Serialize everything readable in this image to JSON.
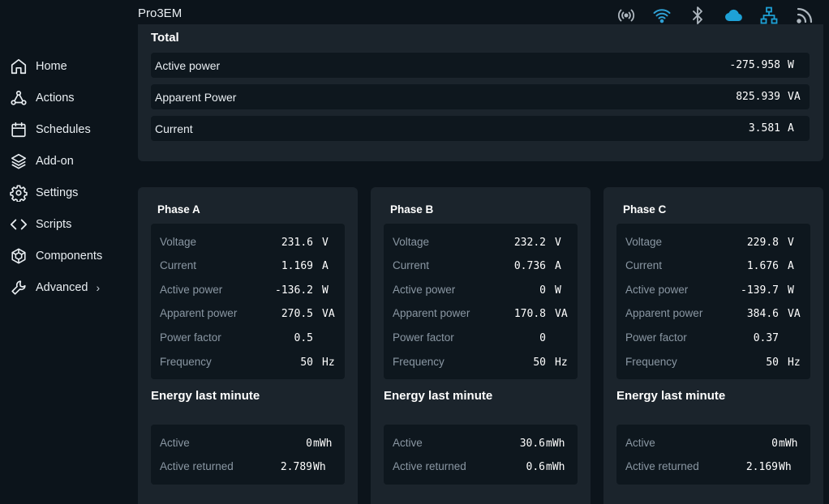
{
  "app": {
    "title": "Pro3EM"
  },
  "status_icons": [
    {
      "name": "broadcast-icon",
      "color": "#aeb7bf"
    },
    {
      "name": "wifi-icon",
      "color": "#2f9fd3"
    },
    {
      "name": "bluetooth-icon",
      "color": "#aeb7bf"
    },
    {
      "name": "cloud-icon",
      "color": "#1ea1d6"
    },
    {
      "name": "ethernet-icon",
      "color": "#1ea1d6"
    },
    {
      "name": "rss-icon",
      "color": "#aeb7bf"
    }
  ],
  "sidebar": {
    "items": [
      {
        "label": "Home",
        "icon": "home-icon"
      },
      {
        "label": "Actions",
        "icon": "actions-icon"
      },
      {
        "label": "Schedules",
        "icon": "calendar-icon"
      },
      {
        "label": "Add-on",
        "icon": "layers-icon"
      },
      {
        "label": "Settings",
        "icon": "gear-icon"
      },
      {
        "label": "Scripts",
        "icon": "code-icon"
      },
      {
        "label": "Components",
        "icon": "components-icon"
      },
      {
        "label": "Advanced",
        "icon": "wrench-icon",
        "has_submenu": true,
        "chevron": "›"
      }
    ]
  },
  "total": {
    "title": "Total",
    "rows": [
      {
        "label": "Active power",
        "value": "-275.958",
        "unit": "W"
      },
      {
        "label": "Apparent Power",
        "value": "825.939",
        "unit": "VA"
      },
      {
        "label": "Current",
        "value": "3.581",
        "unit": "A"
      }
    ]
  },
  "phases": [
    {
      "title": "Phase A",
      "rows": [
        {
          "label": "Voltage",
          "value": "231.6",
          "unit": "V"
        },
        {
          "label": "Current",
          "value": "1.169",
          "unit": "A"
        },
        {
          "label": "Active power",
          "value": "-136.2",
          "unit": "W"
        },
        {
          "label": "Apparent power",
          "value": "270.5",
          "unit": "VA"
        },
        {
          "label": "Power factor",
          "value": "0.5",
          "unit": ""
        },
        {
          "label": "Frequency",
          "value": "50",
          "unit": "Hz"
        }
      ],
      "energy_title": "Energy last minute",
      "energy": [
        {
          "label": "Active",
          "value": "0",
          "unit": "mWh"
        },
        {
          "label": "Active returned",
          "value": "2.789",
          "unit": "Wh"
        }
      ]
    },
    {
      "title": "Phase B",
      "rows": [
        {
          "label": "Voltage",
          "value": "232.2",
          "unit": "V"
        },
        {
          "label": "Current",
          "value": "0.736",
          "unit": "A"
        },
        {
          "label": "Active power",
          "value": "0",
          "unit": "W"
        },
        {
          "label": "Apparent power",
          "value": "170.8",
          "unit": "VA"
        },
        {
          "label": "Power factor",
          "value": "0",
          "unit": ""
        },
        {
          "label": "Frequency",
          "value": "50",
          "unit": "Hz"
        }
      ],
      "energy_title": "Energy last minute",
      "energy": [
        {
          "label": "Active",
          "value": "30.6",
          "unit": "mWh"
        },
        {
          "label": "Active returned",
          "value": "0.6",
          "unit": "mWh"
        }
      ]
    },
    {
      "title": "Phase C",
      "rows": [
        {
          "label": "Voltage",
          "value": "229.8",
          "unit": "V"
        },
        {
          "label": "Current",
          "value": "1.676",
          "unit": "A"
        },
        {
          "label": "Active power",
          "value": "-139.7",
          "unit": "W"
        },
        {
          "label": "Apparent power",
          "value": "384.6",
          "unit": "VA"
        },
        {
          "label": "Power factor",
          "value": "0.37",
          "unit": ""
        },
        {
          "label": "Frequency",
          "value": "50",
          "unit": "Hz"
        }
      ],
      "energy_title": "Energy last minute",
      "energy": [
        {
          "label": "Active",
          "value": "0",
          "unit": "mWh"
        },
        {
          "label": "Active returned",
          "value": "2.169",
          "unit": "Wh"
        }
      ]
    }
  ]
}
